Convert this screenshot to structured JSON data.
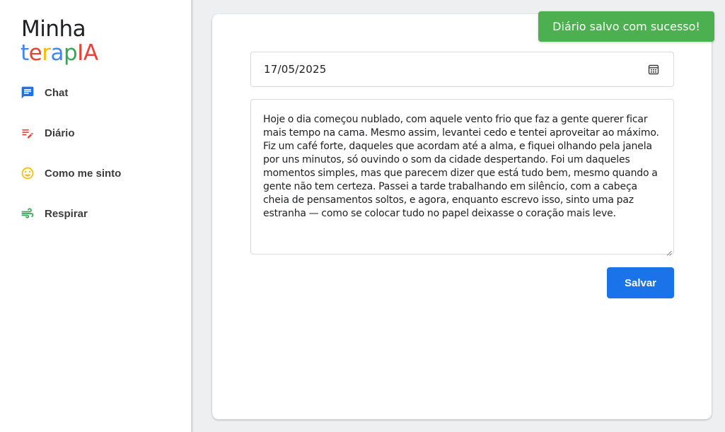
{
  "logo": {
    "line1": "Minha",
    "line2_letters": [
      {
        "char": "t",
        "color": "#4285f4"
      },
      {
        "char": "e",
        "color": "#ea4335"
      },
      {
        "char": "r",
        "color": "#fbbc05"
      },
      {
        "char": "a",
        "color": "#4285f4"
      },
      {
        "char": "p",
        "color": "#34a853"
      },
      {
        "char": "I",
        "color": "#ea4335"
      },
      {
        "char": "A",
        "color": "#ea4335"
      }
    ]
  },
  "sidebar": {
    "items": [
      {
        "label": "Chat",
        "icon": "chat-bubble-icon",
        "color": "#1a73e8"
      },
      {
        "label": "Diário",
        "icon": "edit-notes-icon",
        "color": "#ea4335"
      },
      {
        "label": "Como me sinto",
        "icon": "smiley-icon",
        "color": "#fbbc05"
      },
      {
        "label": "Respirar",
        "icon": "wind-icon",
        "color": "#34a853"
      }
    ]
  },
  "diary": {
    "date": "17/05/2025",
    "text": "Hoje o dia começou nublado, com aquele vento frio que faz a gente querer ficar mais tempo na cama. Mesmo assim, levantei cedo e tentei aproveitar ao máximo. Fiz um café forte, daqueles que acordam até a alma, e fiquei olhando pela janela por uns minutos, só ouvindo o som da cidade despertando. Foi um daqueles momentos simples, mas que parecem dizer que está tudo bem, mesmo quando a gente não tem certeza. Passei a tarde trabalhando em silêncio, com a cabeça cheia de pensamentos soltos, e agora, enquanto escrevo isso, sinto uma paz estranha — como se colocar tudo no papel deixasse o coração mais leve.",
    "save_label": "Salvar"
  },
  "toast": {
    "message": "Diário salvo com sucesso!",
    "color": "#4caf50"
  },
  "colors": {
    "primary": "#1a73e8",
    "success": "#4caf50"
  }
}
